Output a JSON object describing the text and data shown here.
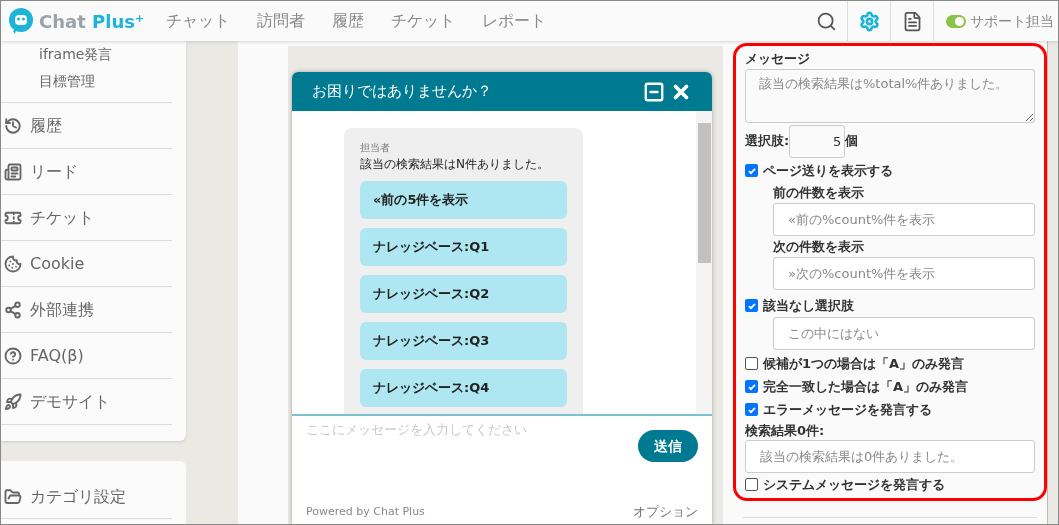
{
  "header": {
    "logo": {
      "text": "Chat",
      "accent": "Plus",
      "sup": "+"
    },
    "nav": [
      {
        "label": "チャット",
        "selected": false
      },
      {
        "label": "訪問者",
        "selected": false
      },
      {
        "label": "履歴",
        "selected": false
      },
      {
        "label": "チケット",
        "selected": false
      },
      {
        "label": "レポート",
        "selected": false
      }
    ],
    "tools": [
      {
        "kind": "search",
        "selected": false
      },
      {
        "kind": "settings",
        "selected": true
      },
      {
        "kind": "document",
        "selected": false
      }
    ],
    "status_toggle": {
      "on": true,
      "label": "サポート担当"
    }
  },
  "sidebar": {
    "sub_items": [
      "iframe発言",
      "目標管理"
    ],
    "items": [
      {
        "kind": "history",
        "label": "履歴"
      },
      {
        "kind": "lead",
        "label": "リード"
      },
      {
        "kind": "ticket",
        "label": "チケット"
      },
      {
        "kind": "cookie",
        "label": "Cookie"
      },
      {
        "kind": "share",
        "label": "外部連携"
      },
      {
        "kind": "help",
        "label": "FAQ(β)"
      },
      {
        "kind": "rocket",
        "label": "デモサイト"
      }
    ],
    "bottom_items": [
      {
        "kind": "folder",
        "label": "カテゴリ設定"
      }
    ]
  },
  "chat_preview": {
    "title": "お困りではありませんか？",
    "operator_label": "担当者",
    "message": "該当の検索結果はN件ありました。",
    "options": [
      "«前の5件を表示",
      "ナレッジベース:Q1",
      "ナレッジベース:Q2",
      "ナレッジベース:Q3",
      "ナレッジベース:Q4"
    ],
    "input_placeholder": "ここにメッセージを入力してください",
    "send": "送信",
    "powered_by": "Powered by Chat Plus",
    "option_link": "オプション"
  },
  "settings": {
    "message": {
      "label": "メッセージ",
      "placeholder": "該当の検索結果は%total%件ありました。"
    },
    "choice_count": {
      "label": "選択肢:",
      "value": "5",
      "unit": "個"
    },
    "paging": {
      "label": "ページ送りを表示する",
      "checked": true,
      "children": [
        {
          "label": "前の件数を表示",
          "placeholder": "«前の%count%件を表示"
        },
        {
          "label": "次の件数を表示",
          "placeholder": "»次の%count%件を表示"
        }
      ]
    },
    "none_option": {
      "label": "該当なし選択肢",
      "checked": true,
      "placeholder": "この中にはない"
    },
    "options": [
      {
        "label": "候補が1つの場合は「A」のみ発言",
        "checked": false
      },
      {
        "label": "完全一致した場合は「A」のみ発言",
        "checked": true
      },
      {
        "label": "エラーメッセージを発言する",
        "checked": true
      }
    ],
    "zero_results": {
      "label": "検索結果0件:",
      "placeholder": "該当の検索結果は0件ありました。"
    },
    "system_message": {
      "label": "システムメッセージを発言する",
      "checked": false
    }
  }
}
